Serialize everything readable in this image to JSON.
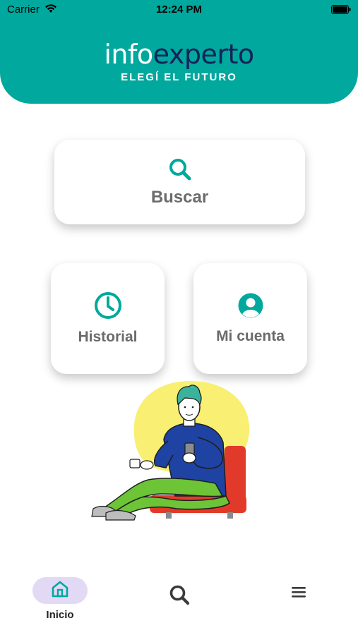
{
  "status_bar": {
    "carrier": "Carrier",
    "time": "12:24 PM"
  },
  "header": {
    "logo_part1": "info",
    "logo_part2": "experto",
    "tagline": "ELEGÍ  EL FUTURO"
  },
  "cards": {
    "search": {
      "label": "Buscar",
      "icon": "search-icon"
    },
    "history": {
      "label": "Historial",
      "icon": "clock-icon"
    },
    "account": {
      "label": "Mi cuenta",
      "icon": "user-icon"
    }
  },
  "bottom_nav": {
    "home": {
      "label": "Inicio",
      "icon": "home-icon",
      "active": true
    },
    "search": {
      "icon": "search-icon"
    },
    "menu": {
      "icon": "hamburger-menu-icon"
    }
  },
  "colors": {
    "brand_teal": "#00a89d",
    "brand_navy": "#15235a",
    "active_pill": "#e2d9f5",
    "card_text": "#6b6b6b"
  }
}
